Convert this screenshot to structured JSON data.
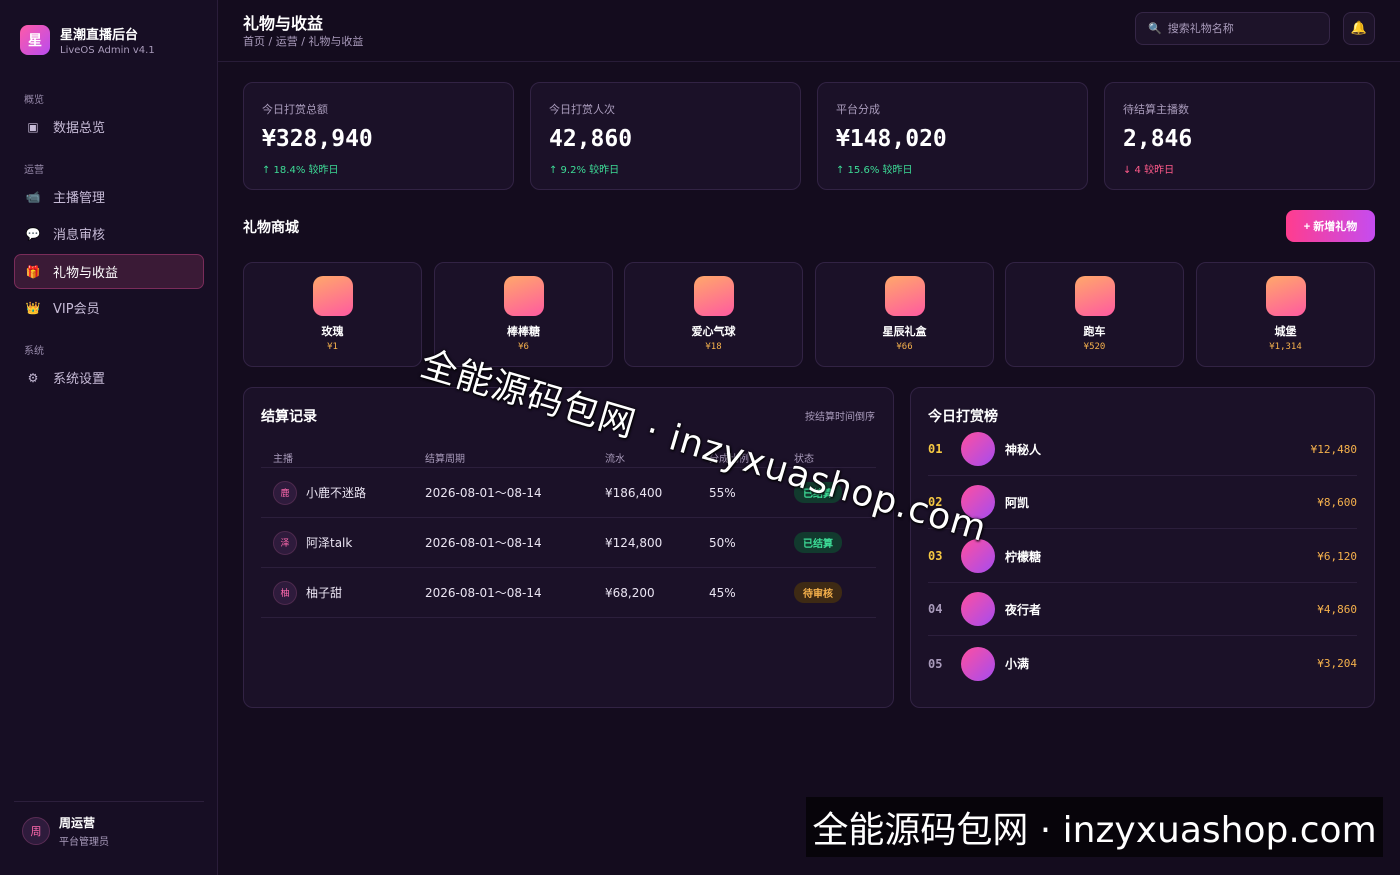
{
  "brand": {
    "logo_char": "星",
    "title": "星潮直播后台",
    "subtitle": "LiveOS Admin v4.1"
  },
  "nav": {
    "groups": [
      {
        "label": "概览"
      },
      {
        "label": "运营"
      },
      {
        "label": "系统"
      }
    ],
    "items": [
      {
        "icon": "▣",
        "icon_name": "dashboard-icon",
        "label": "数据总览",
        "active": false
      },
      {
        "icon": "📹",
        "icon_name": "video-camera-icon",
        "label": "主播管理",
        "active": false
      },
      {
        "icon": "💬",
        "icon_name": "speech-bubble-icon",
        "label": "消息审核",
        "active": false
      },
      {
        "icon": "🎁",
        "icon_name": "gift-icon",
        "label": "礼物与收益",
        "active": true
      },
      {
        "icon": "👑",
        "icon_name": "crown-icon",
        "label": "VIP会员",
        "active": false
      },
      {
        "icon": "⚙",
        "icon_name": "gear-icon",
        "label": "系统设置",
        "active": false
      }
    ]
  },
  "user": {
    "avatar_char": "周",
    "name": "周运营",
    "role": "平台管理员"
  },
  "header": {
    "title": "礼物与收益",
    "breadcrumb": "首页 / 运营 / 礼物与收益",
    "search_icon": "🔍",
    "search_placeholder": "搜索礼物名称",
    "bell_icon": "🔔"
  },
  "stats": [
    {
      "label": "今日打赏总额",
      "value": "¥328,940",
      "trend": "↑ 18.4% 较昨日",
      "direction": "up"
    },
    {
      "label": "今日打赏人次",
      "value": "42,860",
      "trend": "↑ 9.2% 较昨日",
      "direction": "up"
    },
    {
      "label": "平台分成",
      "value": "¥148,020",
      "trend": "↑ 15.6% 较昨日",
      "direction": "up"
    },
    {
      "label": "待结算主播数",
      "value": "2,846",
      "trend": "↓ 4 较昨日",
      "direction": "down"
    }
  ],
  "gift_shop": {
    "title": "礼物商城",
    "add_button": "+ 新增礼物",
    "gifts": [
      {
        "name": "玫瑰",
        "price": "¥1"
      },
      {
        "name": "棒棒糖",
        "price": "¥6"
      },
      {
        "name": "爱心气球",
        "price": "¥18"
      },
      {
        "name": "星辰礼盒",
        "price": "¥66"
      },
      {
        "name": "跑车",
        "price": "¥520"
      },
      {
        "name": "城堡",
        "price": "¥1,314"
      }
    ]
  },
  "settlement": {
    "title": "结算记录",
    "sort_note": "按结算时间倒序",
    "columns": [
      "主播",
      "结算周期",
      "流水",
      "分成比例",
      "状态"
    ],
    "rows": [
      {
        "avatar": "鹿",
        "anchor": "小鹿不迷路",
        "period": "2026-08-01～08-14",
        "flow": "¥186,400",
        "ratio": "55%",
        "status": "已结算",
        "status_type": "done"
      },
      {
        "avatar": "泽",
        "anchor": "阿泽talk",
        "period": "2026-08-01～08-14",
        "flow": "¥124,800",
        "ratio": "50%",
        "status": "已结算",
        "status_type": "done"
      },
      {
        "avatar": "柚",
        "anchor": "柚子甜",
        "period": "2026-08-01～08-14",
        "flow": "¥68,200",
        "ratio": "45%",
        "status": "待审核",
        "status_type": "pending"
      }
    ]
  },
  "leaderboard": {
    "title": "今日打赏榜",
    "entries": [
      {
        "rank": "01",
        "name": "神秘人",
        "amount": "¥12,480"
      },
      {
        "rank": "02",
        "name": "阿凯",
        "amount": "¥8,600"
      },
      {
        "rank": "03",
        "name": "柠檬糖",
        "amount": "¥6,120"
      },
      {
        "rank": "04",
        "name": "夜行者",
        "amount": "¥4,860"
      },
      {
        "rank": "05",
        "name": "小满",
        "amount": "¥3,204"
      }
    ]
  },
  "watermark": {
    "text": "全能源码包网 · inzyxuashop.com"
  },
  "colors": {
    "accent": "#ff3d8e",
    "accent2": "#c54cf0",
    "up": "#3ddc97",
    "down": "#ff5a8a",
    "gold": "#f5b14c"
  }
}
